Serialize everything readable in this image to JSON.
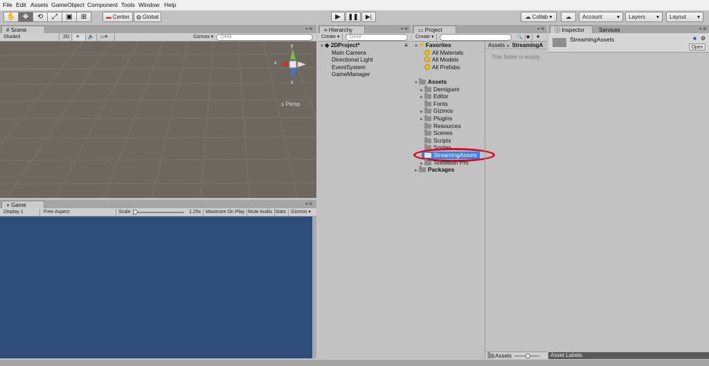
{
  "menubar": {
    "items": [
      "File",
      "Edit",
      "Assets",
      "GameObject",
      "Component",
      "Tools",
      "Window",
      "Help"
    ]
  },
  "toolbar": {
    "center_label": "Center",
    "global_label": "Global",
    "collab_label": "Collab ▾",
    "account_label": "Account",
    "layers_label": "Layers",
    "layout_label": "Layout"
  },
  "scene": {
    "tab": "Scene",
    "shading": "Shaded",
    "mode_2d": "2D",
    "gizmos": "Gizmos ▾",
    "search_placeholder": "Q▾All",
    "persp_label": "Persp",
    "axis_x": "x",
    "axis_y": "y",
    "axis_z": "z"
  },
  "game": {
    "tab": "Game",
    "display": "Display 1",
    "aspect": "Free Aspect",
    "scale_label": "Scale",
    "scale_value": "1.25x",
    "maximize": "Maximize On Play",
    "mute": "Mute Audio",
    "stats": "Stats",
    "gizmos": "Gizmos ▾"
  },
  "hierarchy": {
    "tab": "Hierarchy",
    "create": "Create ▾",
    "search_placeholder": "Q▾All",
    "scene_name": "2DProject*",
    "items": [
      "Main Camera",
      "Directional Light",
      "EventSystem",
      "GameManager"
    ]
  },
  "project": {
    "tab": "Project",
    "create": "Create ▾",
    "favorites_label": "Favorites",
    "favorites": [
      "All Materials",
      "All Models",
      "All Prefabs"
    ],
    "assets_label": "Assets",
    "folders": [
      {
        "name": "Demigiant",
        "arrow": true
      },
      {
        "name": "Editor",
        "arrow": true
      },
      {
        "name": "Fonts",
        "arrow": false
      },
      {
        "name": "Gizmos",
        "arrow": true
      },
      {
        "name": "Plugins",
        "arrow": true
      },
      {
        "name": "Resources",
        "arrow": false
      },
      {
        "name": "Scenes",
        "arrow": false
      },
      {
        "name": "Scripts",
        "arrow": false
      },
      {
        "name": "Sprites",
        "arrow": false
      },
      {
        "name": "StreamingAssets",
        "arrow": false
      },
      {
        "name": "TextMesh Pro",
        "arrow": true
      }
    ],
    "packages_label": "Packages",
    "breadcrumb_root": "Assets",
    "breadcrumb_sep": "►",
    "breadcrumb_current": "StreamingA",
    "empty_message": "This folder is empty",
    "footer_label": "Assets"
  },
  "inspector": {
    "tab": "Inspector",
    "services_tab": "Services",
    "object_name": "StreamingAssets",
    "open_button": "Open",
    "asset_labels": "Asset Labels"
  },
  "colors": {
    "highlight_ring": "#e0001b",
    "selection": "#3d80df",
    "game_bg": "#2f4d7a",
    "scene_bg": "#6e6760"
  }
}
